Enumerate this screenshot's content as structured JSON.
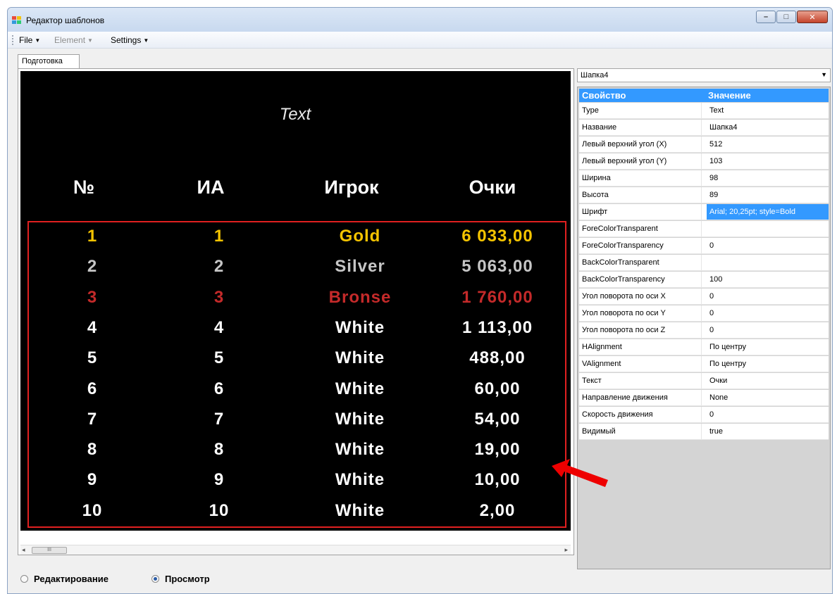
{
  "window": {
    "title": "Редактор шаблонов",
    "min_label": "–",
    "max_label": "□",
    "close_label": "✕"
  },
  "menu": {
    "file": "File",
    "element": "Element",
    "settings": "Settings"
  },
  "tab": {
    "label": "Подготовка"
  },
  "canvas": {
    "text_element": "Text",
    "headers": {
      "num": "№",
      "ia": "ИА",
      "player": "Игрок",
      "score": "Очки"
    },
    "rows": [
      {
        "num": "1",
        "ia": "1",
        "player": "Gold",
        "score": "6 033,00",
        "color": "#f5c400"
      },
      {
        "num": "2",
        "ia": "2",
        "player": "Silver",
        "score": "5 063,00",
        "color": "#c6c6c6"
      },
      {
        "num": "3",
        "ia": "3",
        "player": "Bronse",
        "score": "1 760,00",
        "color": "#c42a2a"
      },
      {
        "num": "4",
        "ia": "4",
        "player": "White",
        "score": "1 113,00",
        "color": "#ffffff"
      },
      {
        "num": "5",
        "ia": "5",
        "player": "White",
        "score": "488,00",
        "color": "#ffffff"
      },
      {
        "num": "6",
        "ia": "6",
        "player": "White",
        "score": "60,00",
        "color": "#ffffff"
      },
      {
        "num": "7",
        "ia": "7",
        "player": "White",
        "score": "54,00",
        "color": "#ffffff"
      },
      {
        "num": "8",
        "ia": "8",
        "player": "White",
        "score": "19,00",
        "color": "#ffffff"
      },
      {
        "num": "9",
        "ia": "9",
        "player": "White",
        "score": "10,00",
        "color": "#ffffff"
      },
      {
        "num": "10",
        "ia": "10",
        "player": "White",
        "score": "2,00",
        "color": "#ffffff"
      }
    ]
  },
  "scrollbar": {
    "thumb_label": "III",
    "left_arrow": "◂",
    "right_arrow": "▸"
  },
  "element_selector": {
    "value": "Шапка4"
  },
  "property_grid": {
    "col_property": "Свойство",
    "col_value": "Значение",
    "rows": [
      {
        "key": "Type",
        "value": "Text"
      },
      {
        "key": "Название",
        "value": "Шапка4"
      },
      {
        "key": "Левый верхний угол (X)",
        "value": "512"
      },
      {
        "key": "Левый верхний угол (Y)",
        "value": "103"
      },
      {
        "key": "Ширина",
        "value": "98"
      },
      {
        "key": "Высота",
        "value": "89"
      },
      {
        "key": "Шрифт",
        "value": "Arial; 20,25pt; style=Bold",
        "selected": true
      },
      {
        "key": "ForeColorTransparent",
        "value": ""
      },
      {
        "key": "ForeColorTransparency",
        "value": "0"
      },
      {
        "key": "BackColorTransparent",
        "value": ""
      },
      {
        "key": "BackColorTransparency",
        "value": "100"
      },
      {
        "key": "Угол поворота по оси X",
        "value": "0"
      },
      {
        "key": "Угол поворота по оси Y",
        "value": "0"
      },
      {
        "key": "Угол поворота по оси Z",
        "value": "0"
      },
      {
        "key": "HAlignment",
        "value": "По центру"
      },
      {
        "key": "VAlignment",
        "value": "По центру"
      },
      {
        "key": "Текст",
        "value": "Очки"
      },
      {
        "key": "Направление движения",
        "value": "None"
      },
      {
        "key": "Скорость движения",
        "value": "0"
      },
      {
        "key": "Видимый",
        "value": "true"
      }
    ]
  },
  "mode": {
    "edit_label": "Редактирование",
    "view_label": "Просмотр",
    "selected": "view"
  },
  "colors": {
    "accent": "#3399ff",
    "highlight_frame": "#e02020",
    "annotation_arrow": "#ee0000"
  }
}
